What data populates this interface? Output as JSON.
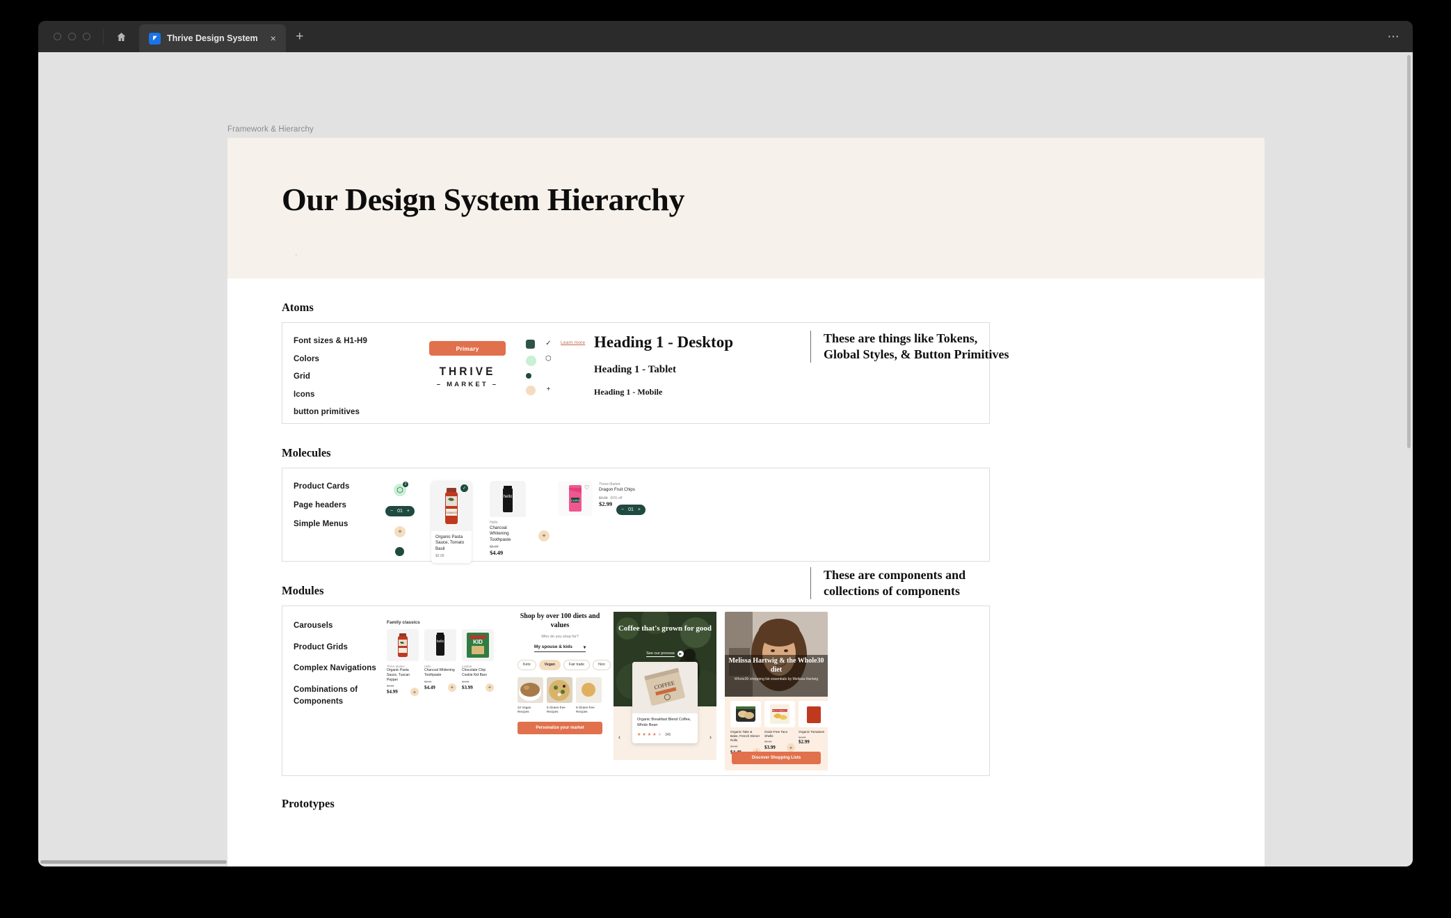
{
  "browser": {
    "tab_title": "Thrive Design System",
    "close_label": "×",
    "newtab_label": "+",
    "more_label": "⋯"
  },
  "canvas": {
    "breadcrumb": "Framework & Hierarchy",
    "hero_title": "Our Design System Hierarchy"
  },
  "sections": {
    "atoms": "Atoms",
    "molecules": "Molecules",
    "modules": "Modules",
    "prototypes": "Prototypes"
  },
  "atoms": {
    "items": [
      "Font sizes & H1-H9",
      "Colors",
      "Grid",
      "Icons",
      "button primitives"
    ],
    "primary_button": "Primary",
    "logo_top": "THRIVE",
    "logo_bottom": "– MARKET –",
    "learn_more": "Learn more",
    "icons": [
      "check-icon",
      "box-icon",
      "plus-icon"
    ],
    "swatches": [
      "#2f5349",
      "#c8f0d4",
      "#1f4a3f",
      "#f3dcc0"
    ],
    "headings": [
      "Heading 1 - Desktop",
      "Heading 1 - Tablet",
      "Heading 1 - Mobile"
    ]
  },
  "molecules": {
    "items": [
      "Product Cards",
      "Page headers",
      "Simple Menus"
    ],
    "badge_count": "2",
    "stepper": {
      "minus": "−",
      "value": "01",
      "plus": "+"
    },
    "cards": [
      {
        "brand": "",
        "name": "Organic Pasta Sauce, Tomato Basil",
        "price": "$2.99",
        "old": "",
        "badge": "selected"
      },
      {
        "brand": "Hello",
        "name": "Charcoal Whitening Toothpaste",
        "price": "$4.49",
        "old": "$5.99",
        "badge": ""
      },
      {
        "brand": "Thrive Market",
        "name": "Dragon Fruit Chips",
        "price": "$2.99",
        "old": "$7.49",
        "discount": "60% off",
        "badge": "wishlist"
      }
    ]
  },
  "modules": {
    "items": [
      "Carousels",
      "Product Grids",
      "Complex Navigations",
      "Combinations of Components"
    ],
    "grid": {
      "title": "Family classics",
      "products": [
        {
          "brand": "Thrive Market",
          "name": "Organic Pasta Sauce, Tuscan Pepper",
          "old": "$6.00",
          "price": "$4.99",
          "plus": "+"
        },
        {
          "brand": "Hello",
          "name": "Charcoal Whitening Toothpaste",
          "old": "$5.99",
          "price": "$4.49",
          "plus": "+"
        },
        {
          "brand": "Larabar",
          "name": "Chocolate Chip Cookie Kid Bars",
          "old": "$4.00",
          "price": "$3.99",
          "plus": "+"
        }
      ]
    },
    "diets": {
      "heading": "Shop by over 100 diets and values",
      "question": "Who do you shop for?",
      "select_value": "My spouse & kids",
      "chips": [
        "Keto",
        "Vegan",
        "Fair trade",
        "Non"
      ],
      "selected_chip": "Vegan",
      "recipes": [
        "22 Vegan Recipes",
        "9 Gluten-free Recipes",
        "9 Gluten-free Recipes"
      ],
      "cta": "Personalize your market"
    },
    "coffee": {
      "headline": "Coffee that's grown for good",
      "link": "See our process",
      "product": "Organic Breakfast Blend Coffee, Whole Bean",
      "rating": "4.5",
      "reviews": "345",
      "prev": "‹",
      "next": "›"
    },
    "whole30": {
      "title": "Melissa Hartwig & the Whole30 diet",
      "subtitle": "Whole30 shopping list essentials by Melissa Hartwig",
      "products": [
        {
          "name": "Organic Take & Bake, French Dinner Rolls",
          "old": "$6.00",
          "price": "$4.49"
        },
        {
          "name": "Grain-Free Taco Shells",
          "old": "$6.00",
          "price": "$3.99"
        },
        {
          "name": "Organic Tomatoes",
          "old": "$4.00",
          "price": "$2.99"
        }
      ],
      "cta": "Discover Shopping Lists"
    }
  },
  "annotations": {
    "atoms_note": "These are things like Tokens, Global Styles, & Button Primitives",
    "modules_note": "These are components and collections of components"
  },
  "colors": {
    "accent_orange": "#e0714c",
    "dark_green": "#1f4a3f",
    "mint": "#c8f0d4",
    "tan": "#f5ddc0",
    "cream": "#f6f1ea"
  }
}
